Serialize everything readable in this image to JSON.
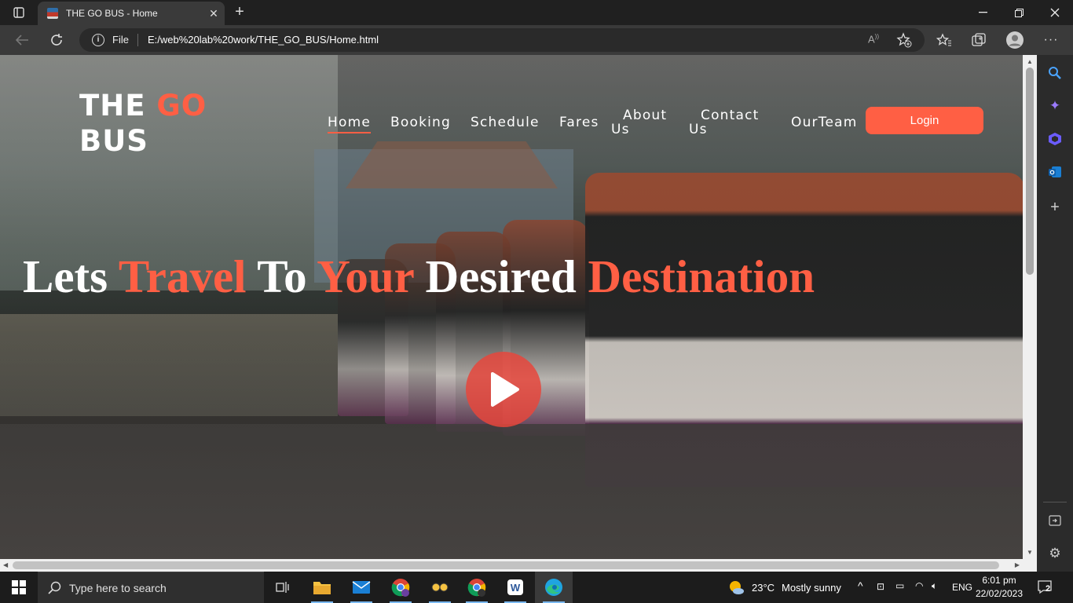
{
  "browser": {
    "tab_title": "THE GO BUS - Home",
    "url_scheme_label": "File",
    "url": "E:/web%20lab%20work/THE_GO_BUS/Home.html"
  },
  "site": {
    "logo_line1_a": "THE",
    "logo_line1_b": "GO",
    "logo_line2": "BUS",
    "nav": {
      "home": "Home",
      "booking": "Booking",
      "schedule": "Schedule",
      "fares": "Fares",
      "about_1": "About",
      "about_2": "Us",
      "contact_1": "Contact",
      "contact_2": "Us",
      "team": "OurTeam",
      "login": "Login"
    },
    "headline": {
      "w1": "Lets",
      "w2": "Travel",
      "w3": "To",
      "w4": "Your",
      "w5": "Desired",
      "w6": "Destination"
    },
    "accent_color": "#ff5f44"
  },
  "taskbar": {
    "search_placeholder": "Type here to search",
    "weather_temp": "23°C",
    "weather_text": "Mostly sunny",
    "language": "ENG",
    "time": "6:01 pm",
    "date": "22/02/2023",
    "notification_count": "2"
  }
}
